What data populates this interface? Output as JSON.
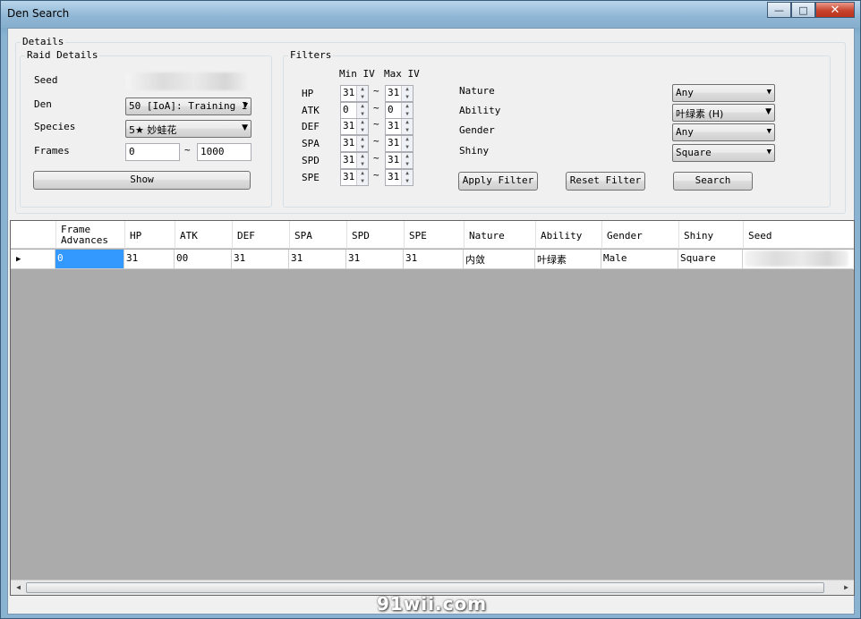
{
  "window": {
    "title": "Den Search",
    "buttons": {
      "minimize": "—",
      "maximize": "□",
      "close": "✕"
    }
  },
  "details": {
    "group_label": "Details",
    "raid": {
      "group_label": "Raid Details",
      "seed_label": "Seed",
      "den_label": "Den",
      "den_value": "50 [IoA]: Training I",
      "species_label": "Species",
      "species_value": "5★ 妙蛙花",
      "frames_label": "Frames",
      "frames_start": "0",
      "frames_tilde": "~",
      "frames_end": "1000",
      "show_button": "Show"
    },
    "filters": {
      "group_label": "Filters",
      "min_iv_label": "Min IV",
      "max_iv_label": "Max IV",
      "stats": [
        {
          "name": "HP",
          "min": "31",
          "max": "31"
        },
        {
          "name": "ATK",
          "min": "0",
          "max": "0"
        },
        {
          "name": "DEF",
          "min": "31",
          "max": "31"
        },
        {
          "name": "SPA",
          "min": "31",
          "max": "31"
        },
        {
          "name": "SPD",
          "min": "31",
          "max": "31"
        },
        {
          "name": "SPE",
          "min": "31",
          "max": "31"
        }
      ],
      "tilde": "~",
      "nature_label": "Nature",
      "nature_value": "Any",
      "ability_label": "Ability",
      "ability_value": "叶绿素 (H)",
      "gender_label": "Gender",
      "gender_value": "Any",
      "shiny_label": "Shiny",
      "shiny_value": "Square",
      "apply_button": "Apply Filter",
      "reset_button": "Reset Filter",
      "search_button": "Search"
    }
  },
  "grid": {
    "columns": [
      "Frame Advances",
      "HP",
      "ATK",
      "DEF",
      "SPA",
      "SPD",
      "SPE",
      "Nature",
      "Ability",
      "Gender",
      "Shiny",
      "Seed"
    ],
    "rows": [
      [
        "0",
        "31",
        "00",
        "31",
        "31",
        "31",
        "31",
        "内敛",
        "叶绿素",
        "Male",
        "Square",
        ""
      ]
    ],
    "row_indicator": "▶"
  },
  "watermark": "91wii.com",
  "icons": {
    "dropdown": "chevron-down-icon",
    "spin_up": "spin-up-icon",
    "spin_down": "spin-down-icon"
  }
}
